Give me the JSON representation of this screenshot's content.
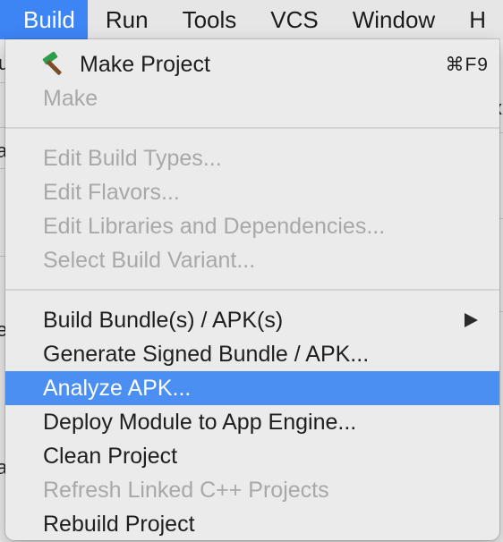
{
  "menubar": {
    "items": [
      {
        "label": "Build",
        "active": true
      },
      {
        "label": "Run"
      },
      {
        "label": "Tools"
      },
      {
        "label": "VCS"
      },
      {
        "label": "Window"
      },
      {
        "label": "H"
      }
    ]
  },
  "build_menu": {
    "make_project": {
      "label": "Make Project",
      "shortcut": "⌘F9",
      "icon": "hammer-icon"
    },
    "make": {
      "label": "Make"
    },
    "edit_build_types": {
      "label": "Edit Build Types..."
    },
    "edit_flavors": {
      "label": "Edit Flavors..."
    },
    "edit_libraries": {
      "label": "Edit Libraries and Dependencies..."
    },
    "select_build_variant": {
      "label": "Select Build Variant..."
    },
    "build_bundle": {
      "label": "Build Bundle(s) / APK(s)"
    },
    "generate_signed": {
      "label": "Generate Signed Bundle / APK..."
    },
    "analyze_apk": {
      "label": "Analyze APK..."
    },
    "deploy_module": {
      "label": "Deploy Module to App Engine..."
    },
    "clean_project": {
      "label": "Clean Project"
    },
    "refresh_linked": {
      "label": "Refresh Linked C++ Projects"
    },
    "rebuild_project": {
      "label": "Rebuild Project"
    }
  },
  "background": {
    "fragments": [
      "u",
      "a",
      "e",
      "a",
      "x"
    ]
  },
  "colors": {
    "menubar_active": "#3d84f5",
    "highlight": "#4a8ff1",
    "disabled_text": "#a8a8a8",
    "hammer_head": "#2f9e4a"
  }
}
